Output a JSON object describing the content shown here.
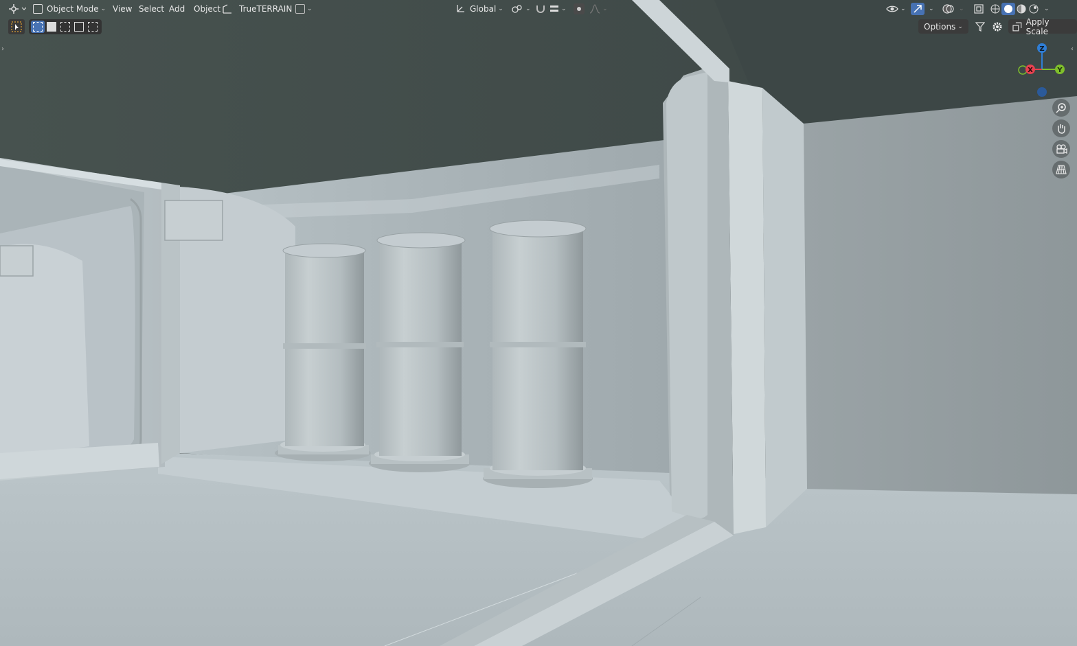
{
  "header": {
    "editor_type_icon": "editor-type-icon",
    "mode": "Object Mode",
    "menus": [
      "View",
      "Select",
      "Add",
      "Object"
    ],
    "addon_label": "TrueTERRAIN",
    "transform_orientation": "Global",
    "options_label": "Options",
    "apply_scale_label": "Apply Scale"
  },
  "gizmo": {
    "z": "Z",
    "x": "X",
    "y": "Y",
    "colors": {
      "x": "#e8414f",
      "y": "#7fbf2b",
      "z": "#2f7ed6"
    }
  },
  "icons": {
    "select_box": "select-box-icon",
    "zoom": "zoom-icon",
    "pan": "pan-hand-icon",
    "camera": "camera-icon",
    "perspective": "perspective-grid-icon"
  }
}
